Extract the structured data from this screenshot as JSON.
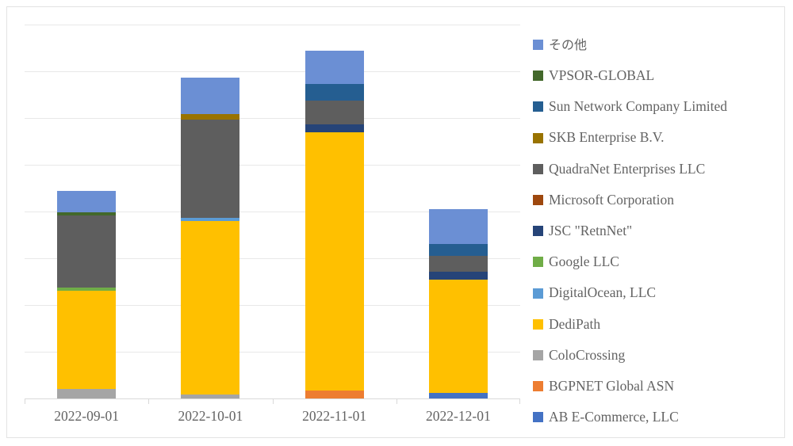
{
  "chart_data": {
    "type": "bar",
    "subtype": "stacked-column",
    "title": "",
    "subtitle": "",
    "xlabel": "",
    "ylabel": "",
    "categories": [
      "2022-09-01",
      "2022-10-01",
      "2022-11-01",
      "2022-12-01"
    ],
    "grid": true,
    "gridline_count": 8,
    "y_tick_labels": [],
    "ylim": [
      0,
      8
    ],
    "legend_position": "right",
    "legend_order_top_to_bottom": [
      "その他",
      "VPSOR-GLOBAL",
      "Sun Network Company Limited",
      "SKB Enterprise B.V.",
      "QuadraNet Enterprises LLC",
      "Microsoft Corporation",
      "JSC \"RetnNet\"",
      "Google LLC",
      "DigitalOcean, LLC",
      "DediPath",
      "ColoCrossing",
      "BGPNET Global ASN",
      "AB E-Commerce, LLC"
    ],
    "series": [
      {
        "name": "AB E-Commerce, LLC",
        "color": "#4472C4",
        "values": [
          0,
          0,
          0,
          0.12
        ]
      },
      {
        "name": "BGPNET Global ASN",
        "color": "#ED7D31",
        "values": [
          0,
          0,
          0.17,
          0
        ]
      },
      {
        "name": "ColoCrossing",
        "color": "#A5A5A5",
        "values": [
          0.21,
          0.09,
          0,
          0
        ]
      },
      {
        "name": "DediPath",
        "color": "#FFC000",
        "values": [
          2.09,
          3.71,
          5.53,
          2.43
        ]
      },
      {
        "name": "DigitalOcean, LLC",
        "color": "#5B9BD5",
        "values": [
          0,
          0.07,
          0,
          0
        ]
      },
      {
        "name": "Google LLC",
        "color": "#70AD47",
        "values": [
          0.07,
          0,
          0,
          0
        ]
      },
      {
        "name": "JSC \"RetnNet\"",
        "color": "#264478",
        "values": [
          0,
          0,
          0.17,
          0.17
        ]
      },
      {
        "name": "Microsoft Corporation",
        "color": "#9E480E",
        "values": [
          0,
          0,
          0,
          0
        ]
      },
      {
        "name": "QuadraNet Enterprises LLC",
        "color": "#5E5E5E",
        "values": [
          1.55,
          2.09,
          0.5,
          0.34
        ]
      },
      {
        "name": "SKB Enterprise B.V.",
        "color": "#997300",
        "values": [
          0,
          0.12,
          0,
          0
        ]
      },
      {
        "name": "Sun Network Company Limited",
        "color": "#255E91",
        "values": [
          0,
          0,
          0.36,
          0.25
        ]
      },
      {
        "name": "VPSOR-GLOBAL",
        "color": "#43682B",
        "values": [
          0.07,
          0,
          0,
          0
        ]
      },
      {
        "name": "その他",
        "color": "#6B8FD4",
        "values": [
          0.46,
          0.79,
          0.71,
          0.75
        ]
      }
    ],
    "totals": [
      4.45,
      6.87,
      7.44,
      4.06
    ]
  },
  "legend": {
    "items": [
      {
        "label": "その他",
        "color": "#6B8FD4",
        "jp": true
      },
      {
        "label": "VPSOR-GLOBAL",
        "color": "#43682B",
        "jp": false
      },
      {
        "label": "Sun Network Company Limited",
        "color": "#255E91",
        "jp": false
      },
      {
        "label": "SKB Enterprise B.V.",
        "color": "#997300",
        "jp": false
      },
      {
        "label": "QuadraNet Enterprises LLC",
        "color": "#5E5E5E",
        "jp": false
      },
      {
        "label": "Microsoft Corporation",
        "color": "#9E480E",
        "jp": false
      },
      {
        "label": "JSC \"RetnNet\"",
        "color": "#264478",
        "jp": false
      },
      {
        "label": "Google LLC",
        "color": "#70AD47",
        "jp": false
      },
      {
        "label": "DigitalOcean, LLC",
        "color": "#5B9BD5",
        "jp": false
      },
      {
        "label": "DediPath",
        "color": "#FFC000",
        "jp": false
      },
      {
        "label": "ColoCrossing",
        "color": "#A5A5A5",
        "jp": false
      },
      {
        "label": "BGPNET Global ASN",
        "color": "#ED7D31",
        "jp": false
      },
      {
        "label": "AB E-Commerce, LLC",
        "color": "#4472C4",
        "jp": false
      }
    ]
  },
  "axis": {
    "categories": [
      "2022-09-01",
      "2022-10-01",
      "2022-11-01",
      "2022-12-01"
    ]
  },
  "colors": {
    "gridline": "#e8e8e8",
    "axis": "#d9d9d9",
    "text": "#636363",
    "frame": "#e3e3e3",
    "background": "#ffffff"
  }
}
